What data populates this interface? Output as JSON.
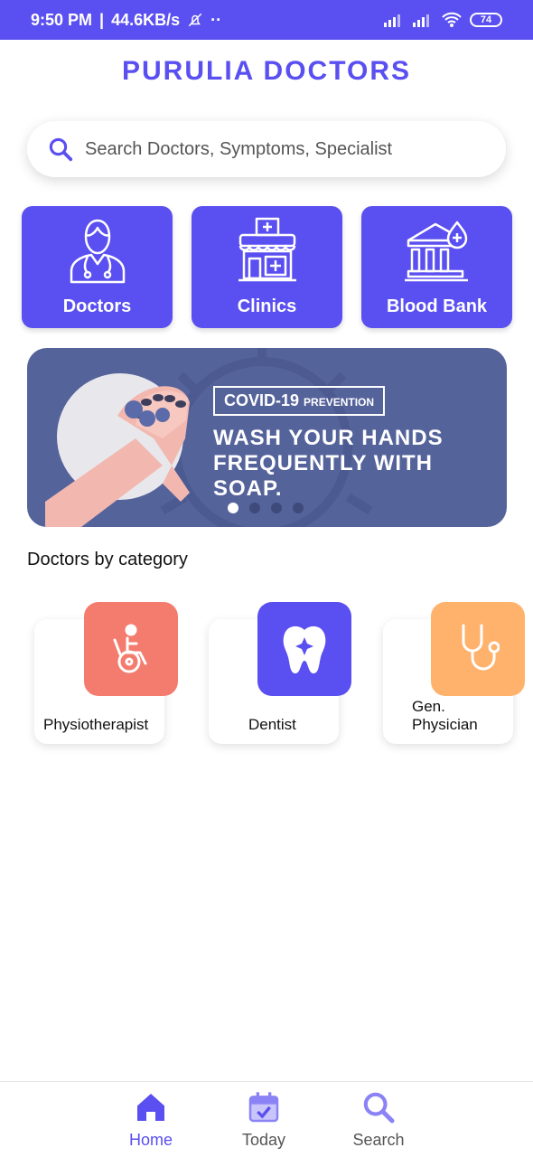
{
  "status_bar": {
    "time": "9:50 PM",
    "speed": "44.6KB/s",
    "extra": "··",
    "battery": "74"
  },
  "app": {
    "title": "PURULIA DOCTORS"
  },
  "search": {
    "placeholder": "Search Doctors, Symptoms, Specialist"
  },
  "tiles": [
    {
      "label": "Doctors",
      "icon": "doctor-icon"
    },
    {
      "label": "Clinics",
      "icon": "clinic-icon"
    },
    {
      "label": "Blood Bank",
      "icon": "blood-bank-icon"
    }
  ],
  "banner": {
    "tag": "COVID-19",
    "tag_small": "PREVENTION",
    "headline_1": "WASH YOUR HANDS",
    "headline_2": "FREQUENTLY WITH",
    "headline_3": "SOAP.",
    "slide_count": 4,
    "active_slide": 1
  },
  "section": {
    "title": "Doctors by category"
  },
  "categories": [
    {
      "label": "Physiotherapist",
      "icon": "wheelchair-icon",
      "color": "#f47c6e"
    },
    {
      "label": "Dentist",
      "icon": "tooth-icon",
      "color": "#5a4ff0"
    },
    {
      "label_1": "Gen.",
      "label_2": "Physician",
      "icon": "stethoscope-icon",
      "color": "#ffb26b"
    }
  ],
  "bottom_nav": {
    "items": [
      {
        "label": "Home",
        "icon": "home-icon",
        "active": true
      },
      {
        "label": "Today",
        "icon": "calendar-icon",
        "active": false
      },
      {
        "label": "Search",
        "icon": "search-icon",
        "active": false
      }
    ]
  },
  "colors": {
    "accent": "#5a4ff0",
    "banner": "#55639b",
    "nav_inactive": "#8b83f5"
  }
}
